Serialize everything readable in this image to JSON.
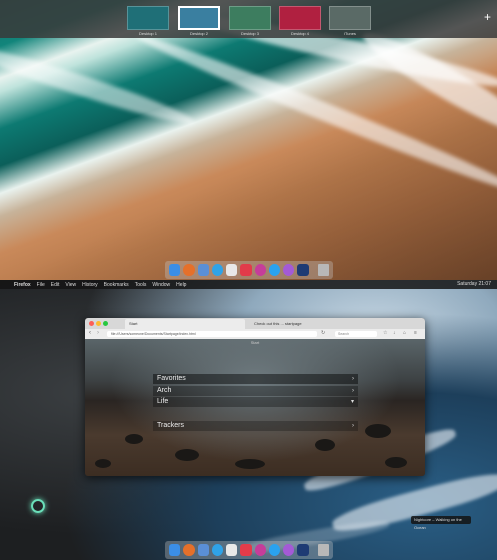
{
  "mission_control": {
    "desktops": [
      {
        "label": "Desktop 1",
        "color": "#1f6f77"
      },
      {
        "label": "Desktop 2",
        "color": "#3a7fa0"
      },
      {
        "label": "Desktop 3",
        "color": "#3d7d5f"
      },
      {
        "label": "Desktop 4",
        "color": "#b02040"
      },
      {
        "label": "iTunes",
        "color": "#5a6a66"
      }
    ],
    "add_label": "+"
  },
  "dock": {
    "icons": [
      "finder-icon",
      "firefox-icon",
      "mail-icon",
      "safari-icon",
      "calendar-icon",
      "music-icon",
      "itunes-icon",
      "twitter-icon",
      "podcasts-icon",
      "photoshop-icon",
      "trash-icon"
    ],
    "colors": [
      "#3b8ee6",
      "#e5702a",
      "#5a8fd6",
      "#2fa3e8",
      "#e8e8e8",
      "#e23b4a",
      "#c63d9a",
      "#2aa2ef",
      "#a45ad6",
      "#1e3b74",
      "#b8b8b8"
    ]
  },
  "menubar": {
    "apple": "",
    "app": "Firefox",
    "items": [
      "File",
      "Edit",
      "View",
      "History",
      "Bookmarks",
      "Tools",
      "Window",
      "Help"
    ],
    "clock": "Saturday 21:07"
  },
  "browser": {
    "tab_title": "Start",
    "tab2_title": "Check out this ... startpage",
    "url": "file:///Users/someone/Documents/Startpage/index.html",
    "search_placeholder": "Search",
    "page_title": "Start",
    "menu": [
      "Favorites",
      "Arch",
      "Life",
      "Trackers"
    ]
  },
  "notification": "Nightcore – Walking on the Ocean"
}
